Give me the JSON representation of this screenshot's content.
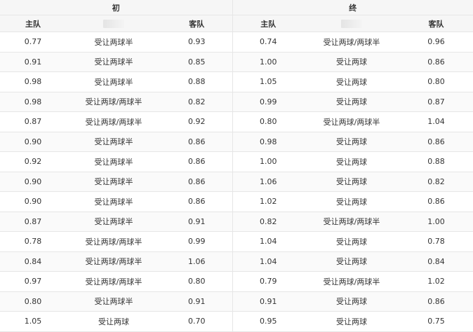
{
  "header": {
    "initial_label": "初",
    "final_label": "终",
    "home_label": "主队",
    "away_label": "客队",
    "handicap_icon": "blurred-placeholder-icon"
  },
  "rows": [
    {
      "init_home": "0.77",
      "init_line": "受让两球半",
      "init_away": "0.93",
      "final_home": "0.74",
      "final_line": "受让两球/两球半",
      "final_away": "0.96"
    },
    {
      "init_home": "0.91",
      "init_line": "受让两球半",
      "init_away": "0.85",
      "final_home": "1.00",
      "final_line": "受让两球",
      "final_away": "0.86"
    },
    {
      "init_home": "0.98",
      "init_line": "受让两球半",
      "init_away": "0.88",
      "final_home": "1.05",
      "final_line": "受让两球",
      "final_away": "0.80"
    },
    {
      "init_home": "0.98",
      "init_line": "受让两球/两球半",
      "init_away": "0.82",
      "final_home": "0.99",
      "final_line": "受让两球",
      "final_away": "0.87"
    },
    {
      "init_home": "0.87",
      "init_line": "受让两球/两球半",
      "init_away": "0.92",
      "final_home": "0.80",
      "final_line": "受让两球/两球半",
      "final_away": "1.04"
    },
    {
      "init_home": "0.90",
      "init_line": "受让两球半",
      "init_away": "0.86",
      "final_home": "0.98",
      "final_line": "受让两球",
      "final_away": "0.86"
    },
    {
      "init_home": "0.92",
      "init_line": "受让两球半",
      "init_away": "0.86",
      "final_home": "1.00",
      "final_line": "受让两球",
      "final_away": "0.88"
    },
    {
      "init_home": "0.90",
      "init_line": "受让两球半",
      "init_away": "0.86",
      "final_home": "1.06",
      "final_line": "受让两球",
      "final_away": "0.82"
    },
    {
      "init_home": "0.90",
      "init_line": "受让两球半",
      "init_away": "0.86",
      "final_home": "1.02",
      "final_line": "受让两球",
      "final_away": "0.86"
    },
    {
      "init_home": "0.87",
      "init_line": "受让两球半",
      "init_away": "0.91",
      "final_home": "0.82",
      "final_line": "受让两球/两球半",
      "final_away": "1.00"
    },
    {
      "init_home": "0.78",
      "init_line": "受让两球/两球半",
      "init_away": "0.99",
      "final_home": "1.04",
      "final_line": "受让两球",
      "final_away": "0.78"
    },
    {
      "init_home": "0.84",
      "init_line": "受让两球/两球半",
      "init_away": "1.06",
      "final_home": "1.04",
      "final_line": "受让两球",
      "final_away": "0.84"
    },
    {
      "init_home": "0.97",
      "init_line": "受让两球/两球半",
      "init_away": "0.80",
      "final_home": "0.79",
      "final_line": "受让两球/两球半",
      "final_away": "1.02"
    },
    {
      "init_home": "0.80",
      "init_line": "受让两球半",
      "init_away": "0.91",
      "final_home": "0.91",
      "final_line": "受让两球",
      "final_away": "0.86"
    },
    {
      "init_home": "1.05",
      "init_line": "受让两球",
      "init_away": "0.70",
      "final_home": "0.95",
      "final_line": "受让两球",
      "final_away": "0.75"
    }
  ]
}
